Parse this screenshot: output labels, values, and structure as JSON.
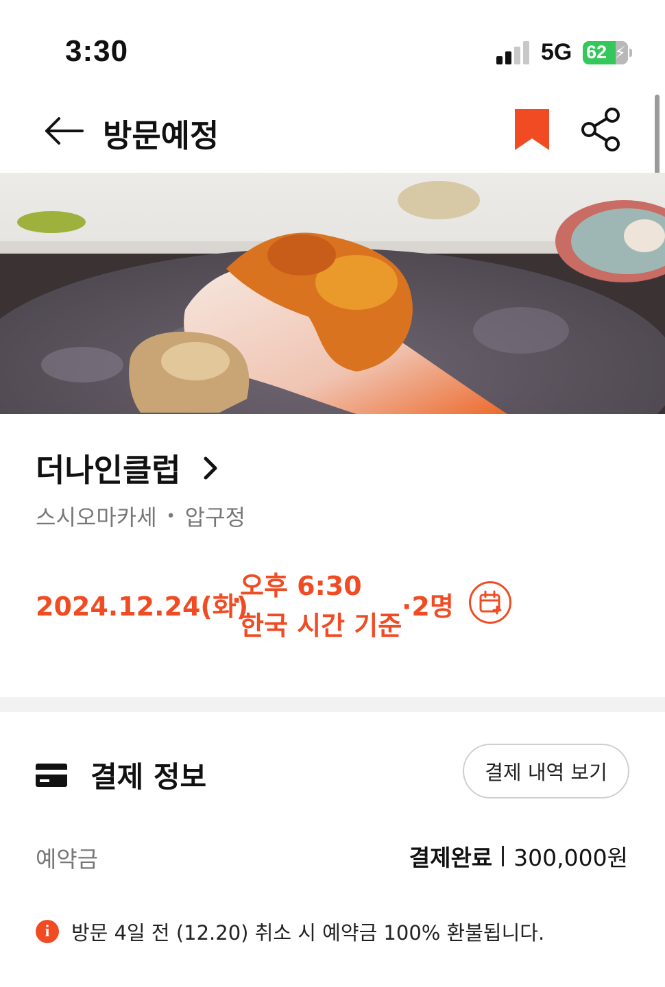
{
  "status_bar": {
    "time": "3:30",
    "network": "5G",
    "battery": "62",
    "battery_level": 0.62
  },
  "header": {
    "title": "방문예정",
    "icons": [
      "back-arrow-icon",
      "bookmark-icon",
      "share-icon"
    ],
    "accent_color": "#f04b23"
  },
  "hero": {
    "icon": "sushi-photo"
  },
  "restaurant": {
    "name": "더나인클럽",
    "category": "스시오마카세",
    "separator": "•",
    "location": "압구정"
  },
  "booking": {
    "date": "2024.12.24(화)",
    "date_sep": "·",
    "time": "오후 6:30",
    "timezone": "한국 시간 기준",
    "party": "·2명"
  },
  "payment": {
    "title": "결제 정보",
    "history_button": "결제 내역 보기",
    "deposit_label": "예약금",
    "deposit_status": "결제완료",
    "deposit_amount": "300,000원",
    "notice": "방문 4일 전 (12.20) 취소 시 예약금 100% 환불됩니다.",
    "info_icon_glyph": "i"
  }
}
